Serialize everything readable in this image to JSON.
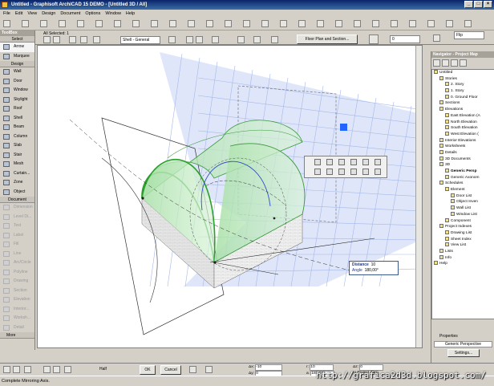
{
  "window": {
    "title": "Untitled - Graphisoft ArchiCAD 15 DEMO - [Untitled 3D / All]"
  },
  "menu": [
    "File",
    "Edit",
    "View",
    "Design",
    "Document",
    "Options",
    "Window",
    "Help"
  ],
  "toolbar": {
    "all_selected": "All Selected: 1",
    "shell_type": "Shell - General",
    "floor_plan_button": "Floor Plan and Section...",
    "value_field": "0",
    "flip_label": "Flip"
  },
  "toolbox": {
    "title": "ToolBox",
    "select_head": "Select",
    "design_head": "Design",
    "document_head": "Document",
    "more": "More",
    "select_tools": [
      "Arrow",
      "Marquee"
    ],
    "design_tools": [
      "Wall",
      "Door",
      "Window",
      "Skylight",
      "Roof",
      "Shell",
      "Beam",
      "Column",
      "Slab",
      "Stair",
      "Mesh",
      "Curtain...",
      "Zone",
      "Object"
    ],
    "document_tools": [
      "Dimension",
      "Level Di...",
      "Text",
      "Label",
      "Fill",
      "Line",
      "Arc/Circle",
      "Polyline",
      "Drawing",
      "Section",
      "Elevation",
      "Interior...",
      "Worksh...",
      "Detail"
    ]
  },
  "navigator": {
    "title": "Navigator - Project Map",
    "tree": [
      {
        "label": "Untitled",
        "depth": 0
      },
      {
        "label": "Stories",
        "depth": 1
      },
      {
        "label": "2. Story",
        "depth": 2
      },
      {
        "label": "1. Story",
        "depth": 2
      },
      {
        "label": "0. Ground Floor",
        "depth": 2
      },
      {
        "label": "Sections",
        "depth": 1
      },
      {
        "label": "Elevations",
        "depth": 1
      },
      {
        "label": "East Elevation (A",
        "depth": 2
      },
      {
        "label": "North Elevation",
        "depth": 2
      },
      {
        "label": "South Elevation",
        "depth": 2
      },
      {
        "label": "West Elevation (",
        "depth": 2
      },
      {
        "label": "Interior Elevations",
        "depth": 1
      },
      {
        "label": "Worksheets",
        "depth": 1
      },
      {
        "label": "Details",
        "depth": 1
      },
      {
        "label": "3D Documents",
        "depth": 1
      },
      {
        "label": "3D",
        "depth": 1
      },
      {
        "label": "Generic Persp",
        "depth": 2,
        "bold": true
      },
      {
        "label": "Generic Axonom",
        "depth": 2
      },
      {
        "label": "Schedules",
        "depth": 1
      },
      {
        "label": "Element",
        "depth": 2
      },
      {
        "label": "Door List",
        "depth": 3
      },
      {
        "label": "Object Inven",
        "depth": 3
      },
      {
        "label": "Wall List",
        "depth": 3
      },
      {
        "label": "Window List",
        "depth": 3
      },
      {
        "label": "Component",
        "depth": 2
      },
      {
        "label": "Project Indexes",
        "depth": 1
      },
      {
        "label": "Drawing List",
        "depth": 2
      },
      {
        "label": "Sheet Index",
        "depth": 2
      },
      {
        "label": "View List",
        "depth": 2
      },
      {
        "label": "Lists",
        "depth": 1
      },
      {
        "label": "Info",
        "depth": 1
      },
      {
        "label": "Help",
        "depth": 0
      }
    ],
    "properties_label": "Properties",
    "view_name": "Generic Perspective",
    "settings_button": "Settings..."
  },
  "tracker": {
    "distance_label": "Distance",
    "distance_value": "10",
    "angle_label": "Angle",
    "angle_value": "180,00°"
  },
  "bottom": {
    "ok": "OK",
    "cancel": "Cancel",
    "dx_label": "Δx:",
    "dx_value": "-10",
    "dy_label": "Δy:",
    "dy_value": "0",
    "r_label": "r:",
    "r_value": "10",
    "a_label": "a:",
    "a_value": "180,00°",
    "dz_label": "Δz:",
    "dz_value": "0",
    "zero_label": "to Project Zero",
    "half_label": "Half"
  },
  "status": "Complete Mirroring Axis.",
  "watermark": "http://grafica2d3d.blogspot.com/",
  "colors": {
    "shell_green": "#5ab85a",
    "grid_blue": "#b8c8f0",
    "accent_blue": "#2266ff",
    "title_blue": "#0a246a"
  }
}
